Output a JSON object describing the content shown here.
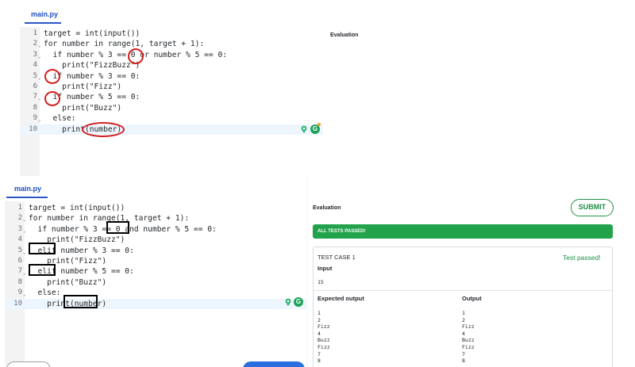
{
  "top": {
    "tab_label": "main.py",
    "evaluation_title": "Evaluation",
    "lines": [
      {
        "num": "1",
        "fold": "",
        "code": "target = int(input())"
      },
      {
        "num": "2",
        "fold": "v",
        "code": "for number in range(1, target + 1):"
      },
      {
        "num": "3",
        "fold": "v",
        "code": "  if number % 3 == 0 or number % 5 == 0:"
      },
      {
        "num": "4",
        "fold": "",
        "code": "    print(\"FizzBuzz\")"
      },
      {
        "num": "5",
        "fold": "v",
        "code": "  if number % 3 == 0:"
      },
      {
        "num": "6",
        "fold": "",
        "code": "    print(\"Fizz\")"
      },
      {
        "num": "7",
        "fold": "v",
        "code": "  if number % 5 == 0:"
      },
      {
        "num": "8",
        "fold": "",
        "code": "    print(\"Buzz\")"
      },
      {
        "num": "9",
        "fold": "v",
        "code": "  else:"
      },
      {
        "num": "10",
        "fold": "",
        "code": "    print(number)"
      }
    ]
  },
  "bottom": {
    "tab_label": "main.py",
    "evaluation_title": "Evaluation",
    "submit_label": "SUBMIT",
    "all_passed_label": "ALL TESTS PASSED!",
    "lines": [
      {
        "num": "1",
        "fold": "",
        "code": "target = int(input())"
      },
      {
        "num": "2",
        "fold": "v",
        "code": "for number in range(1, target + 1):"
      },
      {
        "num": "3",
        "fold": "v",
        "code": "  if number % 3 == 0 and number % 5 == 0:"
      },
      {
        "num": "4",
        "fold": "",
        "code": "    print(\"FizzBuzz\")"
      },
      {
        "num": "5",
        "fold": "v",
        "code": "  elif number % 3 == 0:"
      },
      {
        "num": "6",
        "fold": "",
        "code": "    print(\"Fizz\")"
      },
      {
        "num": "7",
        "fold": "v",
        "code": "  elif number % 5 == 0:"
      },
      {
        "num": "8",
        "fold": "",
        "code": "    print(\"Buzz\")"
      },
      {
        "num": "9",
        "fold": "v",
        "code": "  else:"
      },
      {
        "num": "10",
        "fold": "",
        "code": "    print(number)"
      }
    ],
    "test_case": {
      "title": "TEST CASE 1",
      "status": "Test passed!",
      "input_label": "Input",
      "input_value": "15",
      "expected_label": "Expected output",
      "output_label": "Output",
      "expected_values": [
        "1",
        "2",
        "Fizz",
        "4",
        "Buzz",
        "Fizz",
        "7",
        "8"
      ],
      "output_values": [
        "1",
        "2",
        "Fizz",
        "4",
        "Buzz",
        "Fizz",
        "7",
        "8"
      ]
    }
  },
  "icons": {
    "bulb": "lightbulb-icon",
    "grammarly": "grammarly-icon"
  },
  "colors": {
    "accent_blue": "#2a56c6",
    "success_green": "#22a24a",
    "annotation_red": "#d11f1f",
    "annotation_black": "#000000"
  }
}
